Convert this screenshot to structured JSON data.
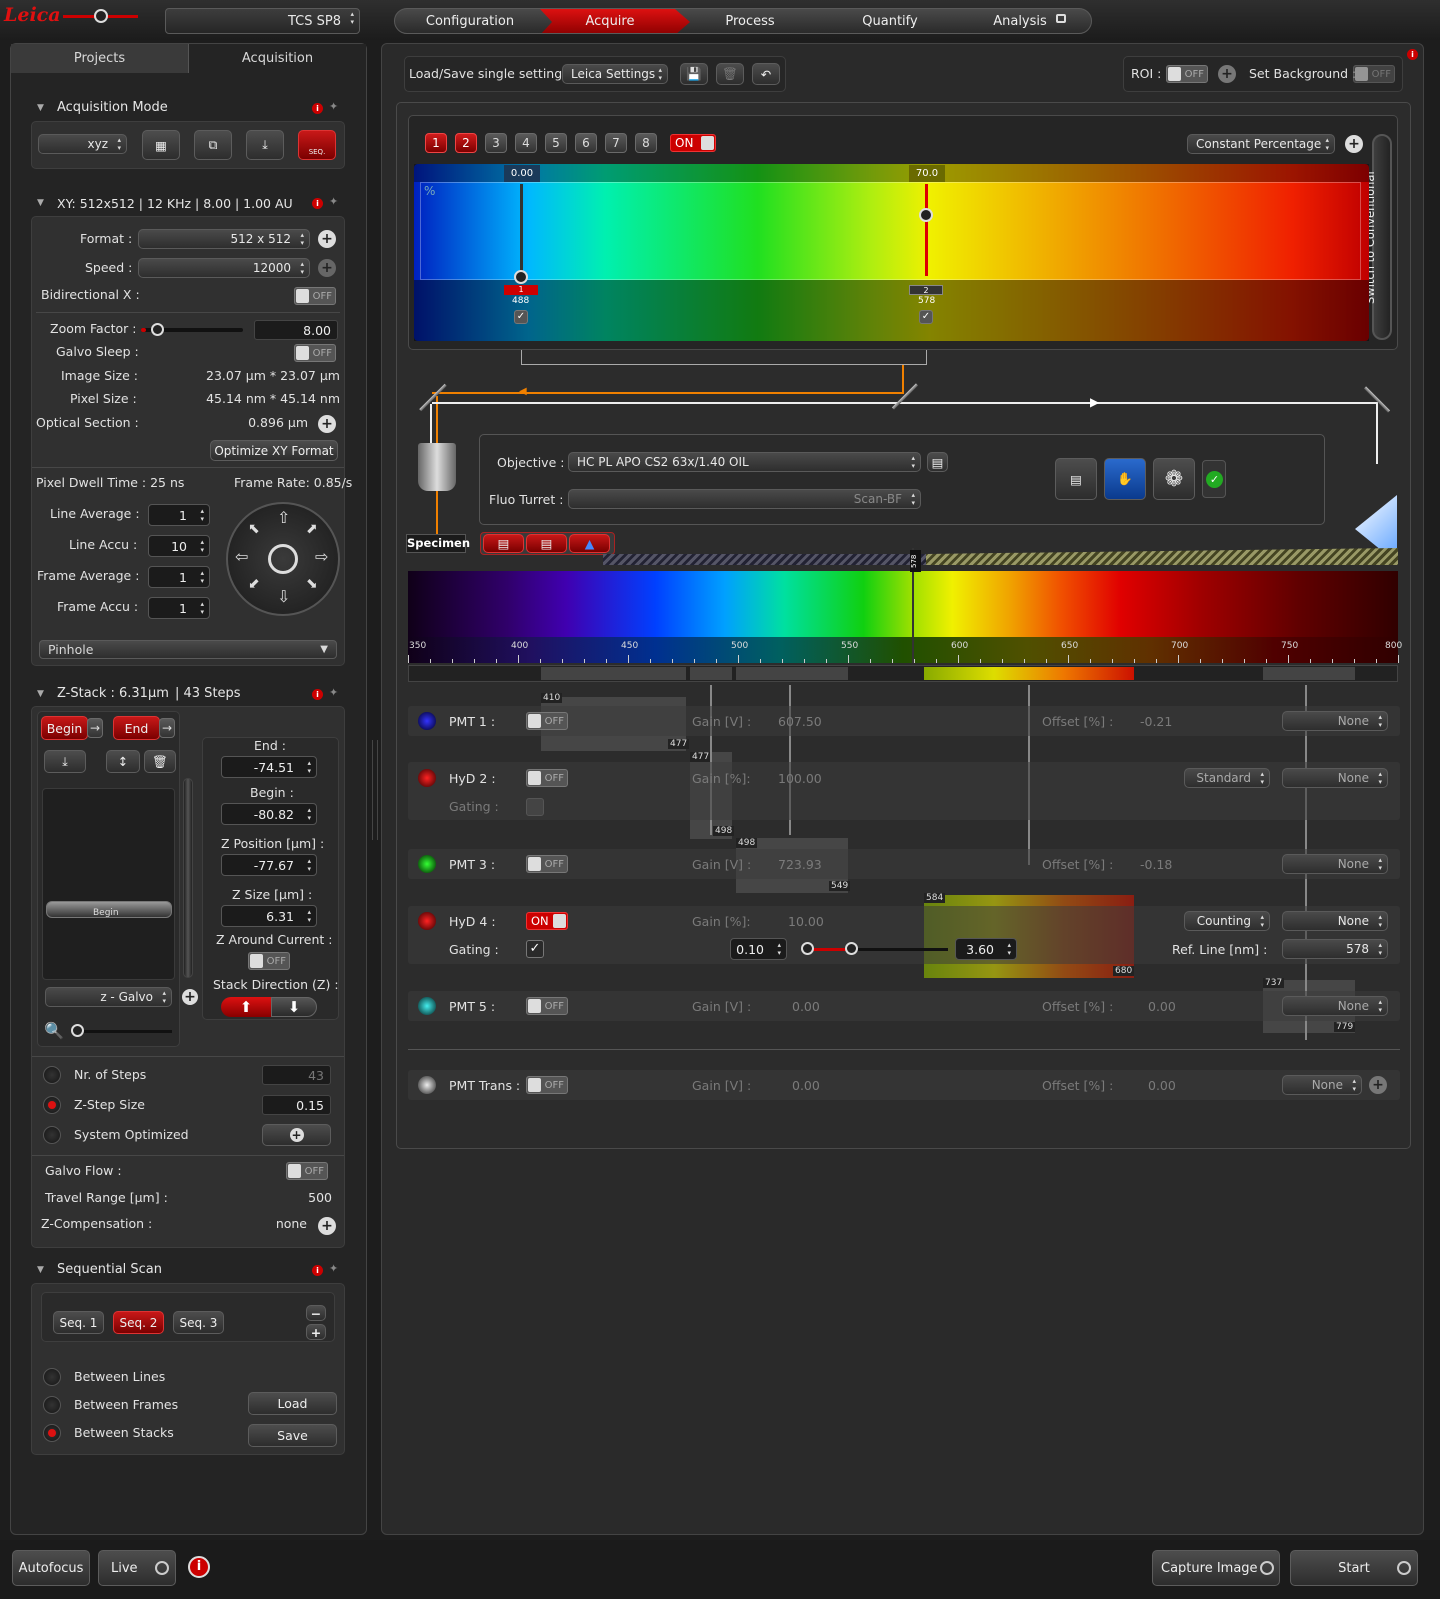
{
  "topbar": {
    "logo": "Leica",
    "system": "TCS SP8",
    "tabs": [
      "Configuration",
      "Acquire",
      "Process",
      "Quantify",
      "Analysis"
    ],
    "active_tab": "Acquire"
  },
  "left": {
    "tabs": [
      "Projects",
      "Acquisition"
    ],
    "acq_mode": {
      "title": "Acquisition Mode",
      "mode": "xyz",
      "seq_label": "SEQ."
    },
    "xy": {
      "title": "XY: 512x512 | 12 KHz | 8.00 | 1.00 AU",
      "format_label": "Format :",
      "format": "512 x 512",
      "speed_label": "Speed :",
      "speed": "12000",
      "bidir_label": "Bidirectional X :",
      "bidir": "OFF",
      "zoom_label": "Zoom Factor :",
      "zoom": "8.00",
      "zoom_level": 0.05,
      "galvo_label": "Galvo Sleep :",
      "galvo": "OFF",
      "image_size_label": "Image Size :",
      "image_size": "23.07 µm * 23.07 µm",
      "pixel_size_label": "Pixel Size :",
      "pixel_size": "45.14 nm * 45.14 nm",
      "optical_label": "Optical Section :",
      "optical": "0.896 µm",
      "optimize": "Optimize XY Format",
      "dwell": "Pixel Dwell Time : 25 ns",
      "frame_rate": "Frame Rate: 0.85/s",
      "line_avg_label": "Line Average :",
      "line_avg": "1",
      "line_accu_label": "Line Accu :",
      "line_accu": "10",
      "frame_avg_label": "Frame Average :",
      "frame_avg": "1",
      "frame_accu_label": "Frame Accu :",
      "frame_accu": "1",
      "pinhole": "Pinhole"
    },
    "zstack": {
      "title": "Z-Stack : 6.31µm",
      "steps_title": "| 43 Steps",
      "begin_btn": "Begin",
      "end_btn": "End",
      "end_label": "End :",
      "end": "-74.51",
      "begin_label": "Begin :",
      "begin": "-80.82",
      "zpos_label": "Z Position [µm] :",
      "zpos": "-77.67",
      "zsize_label": "Z Size [µm] :",
      "zsize": "6.31",
      "zaround_label": "Z Around Current :",
      "zaround": "OFF",
      "dir_label": "Stack Direction (Z) :",
      "slider_label": "Begin",
      "galvo": "z - Galvo",
      "nsteps_label": "Nr. of Steps",
      "nsteps": "43",
      "zstep_label": "Z-Step Size",
      "zstep": "0.15",
      "sysopt_label": "System Optimized",
      "galvo_flow_label": "Galvo Flow :",
      "galvo_flow": "OFF",
      "travel_label": "Travel Range [µm] :",
      "travel": "500",
      "zcomp_label": "Z-Compensation :",
      "zcomp": "none"
    },
    "seq": {
      "title": "Sequential Scan",
      "tabs": [
        "Seq. 1",
        "Seq. 2",
        "Seq. 3"
      ],
      "active": "Seq. 2",
      "opts": [
        "Between Lines",
        "Between Frames",
        "Between Stacks"
      ],
      "load": "Load",
      "save": "Save"
    }
  },
  "main": {
    "loadsave_label": "Load/Save single setting :",
    "setting": "Leica Settings",
    "roi_label": "ROI :",
    "roi": "OFF",
    "bg_label": "Set Background :",
    "bg": "OFF",
    "lasers": [
      "1",
      "2",
      "3",
      "4",
      "5",
      "6",
      "7",
      "8"
    ],
    "laser_on": "ON",
    "mode": "Constant Percentage",
    "switch_text": "Switch to Conventional",
    "pct": "%",
    "laser1": {
      "power": "0.00",
      "line": "1",
      "wl": "488"
    },
    "laser2": {
      "power": "70.0",
      "line": "2",
      "wl": "578"
    },
    "objective_label": "Objective :",
    "objective": "HC PL APO CS2   63x/1.40 OIL",
    "turret_label": "Fluo Turret :",
    "turret": "Scan-BF",
    "specimen": "Specimen",
    "wl_ticks": [
      "350",
      "400",
      "450",
      "500",
      "550",
      "600",
      "650",
      "700",
      "750",
      "800"
    ],
    "laser_mark": "578",
    "detectors": [
      {
        "name": "PMT 1 :",
        "state": "OFF",
        "gain_label": "Gain [V] :",
        "gain": "607.50",
        "offset_label": "Offset [%] :",
        "offset": "-0.21",
        "lut": "None",
        "range": [
          "410",
          "477"
        ]
      },
      {
        "name": "HyD 2 :",
        "state": "OFF",
        "gain_label": "Gain [%]:",
        "gain": "100.00",
        "mode": "Standard",
        "lut": "None",
        "gating_label": "Gating :",
        "range": [
          "477",
          "498"
        ]
      },
      {
        "name": "PMT 3 :",
        "state": "OFF",
        "gain_label": "Gain [V] :",
        "gain": "723.93",
        "offset_label": "Offset [%] :",
        "offset": "-0.18",
        "lut": "None",
        "range": [
          "498",
          "549"
        ]
      },
      {
        "name": "HyD 4 :",
        "state": "ON",
        "gain_label": "Gain [%]:",
        "gain": "10.00",
        "mode": "Counting",
        "lut": "None",
        "gating_label": "Gating :",
        "gate_min": "0.10",
        "gate_max": "3.60",
        "refline_label": "Ref. Line [nm] :",
        "refline": "578",
        "range": [
          "584",
          "680"
        ]
      },
      {
        "name": "PMT 5 :",
        "state": "OFF",
        "gain_label": "Gain [V] :",
        "gain": "0.00",
        "offset_label": "Offset [%] :",
        "offset": "0.00",
        "lut": "None",
        "range": [
          "737",
          "779"
        ]
      },
      {
        "name": "PMT Trans :",
        "state": "OFF",
        "gain_label": "Gain [V] :",
        "gain": "0.00",
        "offset_label": "Offset [%] :",
        "offset": "0.00",
        "lut": "None"
      }
    ]
  },
  "bottom": {
    "autofocus": "Autofocus",
    "live": "Live",
    "capture": "Capture Image",
    "start": "Start"
  }
}
